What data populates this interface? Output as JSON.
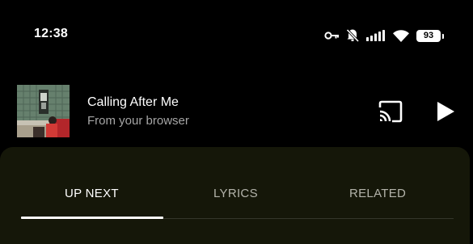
{
  "status_bar": {
    "time": "12:38",
    "battery": "93",
    "icons": [
      "key-icon",
      "mute-icon",
      "signal-icon",
      "wifi-icon",
      "battery-icon"
    ]
  },
  "mini_player": {
    "title": "Calling After Me",
    "subtitle": "From your browser",
    "icons": [
      "cast-icon",
      "play-icon"
    ]
  },
  "tabs": [
    {
      "label": "UP NEXT",
      "active": true
    },
    {
      "label": "LYRICS",
      "active": false
    },
    {
      "label": "RELATED",
      "active": false
    }
  ],
  "colors": {
    "background": "#000000",
    "sheet": "#151709",
    "active_tab": "#ffffff",
    "inactive_tab": "#b3b3aa",
    "subtitle": "#a6a6a6"
  }
}
